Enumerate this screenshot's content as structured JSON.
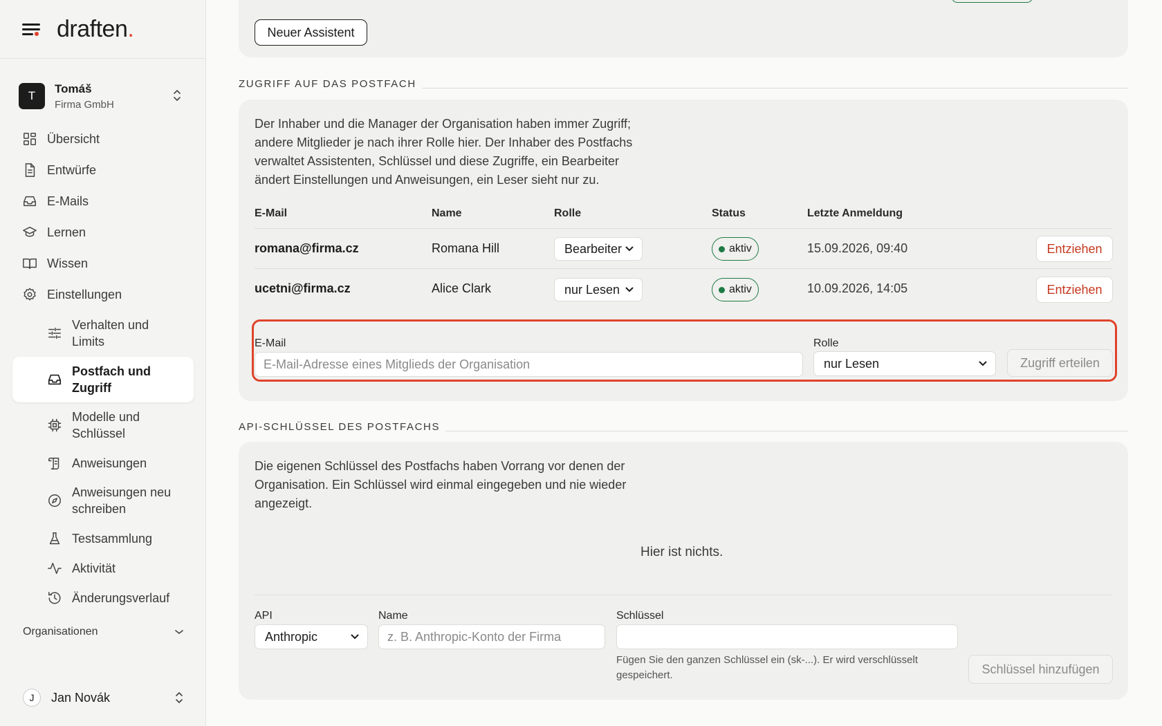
{
  "app": {
    "logo": "draften",
    "logo_dot": "."
  },
  "account": {
    "initial": "T",
    "name": "Tomáš",
    "company": "Firma GmbH"
  },
  "nav": {
    "overview": "Übersicht",
    "drafts": "Entwürfe",
    "emails": "E-Mails",
    "learn": "Lernen",
    "knowledge": "Wissen",
    "settings": "Einstellungen"
  },
  "settings_nav": {
    "behavior_1": "Verhalten und",
    "behavior_2": "Limits",
    "mailbox_1": "Postfach und",
    "mailbox_2": "Zugriff",
    "models_1": "Modelle und",
    "models_2": "Schlüssel",
    "instructions": "Anweisungen",
    "rewrite_1": "Anweisungen neu",
    "rewrite_2": "schreiben",
    "testset": "Testsammlung",
    "activity": "Aktivität",
    "history": "Änderungsverlauf"
  },
  "organizations": "Organisationen",
  "user": {
    "initial": "J",
    "name": "Jan Novák"
  },
  "assistants": {
    "new_button": "Neuer Assistent"
  },
  "access": {
    "title": "ZUGRIFF AUF DAS POSTFACH",
    "description": [
      "Der Inhaber und die Manager der Organisation haben immer Zugriff;",
      "andere Mitglieder je nach ihrer Rolle hier. Der Inhaber des Postfachs",
      "verwaltet Assistenten, Schlüssel und diese Zugriffe, ein Bearbeiter",
      "ändert Einstellungen und Anweisungen, ein Leser sieht nur zu."
    ],
    "columns": {
      "email": "E-Mail",
      "name": "Name",
      "role": "Rolle",
      "status": "Status",
      "last_login": "Letzte Anmeldung"
    },
    "rows": [
      {
        "email": "romana@firma.cz",
        "name": "Romana Hill",
        "role": "Bearbeiter",
        "status": "aktiv",
        "last_login": "15.09.2026, 09:40",
        "action": "Entziehen"
      },
      {
        "email": "ucetni@firma.cz",
        "name": "Alice Clark",
        "role": "nur Lesen",
        "status": "aktiv",
        "last_login": "10.09.2026, 14:05",
        "action": "Entziehen"
      }
    ],
    "form": {
      "email_label": "E-Mail",
      "email_placeholder": "E-Mail-Adresse eines Mitglieds der Organisation",
      "role_label": "Rolle",
      "role_value": "nur Lesen",
      "submit": "Zugriff erteilen"
    }
  },
  "api_keys": {
    "title": "API-SCHLÜSSEL DES POSTFACHS",
    "description": [
      "Die eigenen Schlüssel des Postfachs haben Vorrang vor denen der",
      "Organisation. Ein Schlüssel wird einmal eingegeben und nie wieder",
      "angezeigt."
    ],
    "empty": "Hier ist nichts.",
    "form": {
      "api_label": "API",
      "api_value": "Anthropic",
      "name_label": "Name",
      "name_placeholder": "z. B. Anthropic-Konto der Firma",
      "key_label": "Schlüssel",
      "key_value": "",
      "hint_1": "Fügen Sie den ganzen Schlüssel ein (sk-...). Er wird verschlüsselt",
      "hint_2": "gespeichert.",
      "submit": "Schlüssel hinzufügen"
    }
  },
  "colors": {
    "accent": "#e0432b",
    "status_green": "#1f7a44",
    "revoke_red": "#c4391f"
  }
}
